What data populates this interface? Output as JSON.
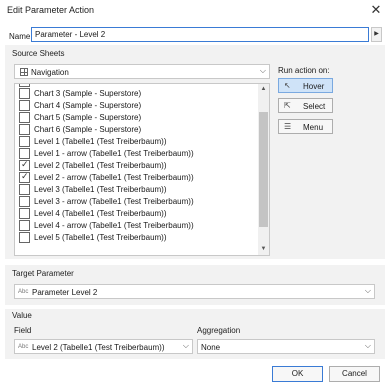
{
  "window": {
    "title": "Edit Parameter Action",
    "close_glyph": "✕"
  },
  "name": {
    "label": "Name:",
    "value": "Parameter - Level 2"
  },
  "source_sheets": {
    "section_label": "Source Sheets",
    "dropdown_value": "Navigation",
    "sheets": [
      {
        "label": "",
        "checked": false
      },
      {
        "label": "Chart 3 (Sample - Superstore)",
        "checked": false
      },
      {
        "label": "Chart 4 (Sample - Superstore)",
        "checked": false
      },
      {
        "label": "Chart 5 (Sample - Superstore)",
        "checked": false
      },
      {
        "label": "Chart 6 (Sample - Superstore)",
        "checked": false
      },
      {
        "label": "Level 1 (Tabelle1 (Test Treiberbaum))",
        "checked": false
      },
      {
        "label": "Level 1 - arrow (Tabelle1 (Test Treiberbaum))",
        "checked": false
      },
      {
        "label": "Level 2 (Tabelle1 (Test Treiberbaum))",
        "checked": true
      },
      {
        "label": "Level 2 - arrow (Tabelle1 (Test Treiberbaum))",
        "checked": true
      },
      {
        "label": "Level 3 (Tabelle1 (Test Treiberbaum))",
        "checked": false
      },
      {
        "label": "Level 3 - arrow (Tabelle1 (Test Treiberbaum))",
        "checked": false
      },
      {
        "label": "Level 4 (Tabelle1 (Test Treiberbaum))",
        "checked": false
      },
      {
        "label": "Level 4 - arrow (Tabelle1 (Test Treiberbaum))",
        "checked": false
      },
      {
        "label": "Level 5 (Tabelle1 (Test Treiberbaum))",
        "checked": false
      }
    ]
  },
  "run_action": {
    "label": "Run action on:",
    "hover": "Hover",
    "select": "Select",
    "menu": "Menu",
    "active": "hover"
  },
  "target": {
    "section_label": "Target Parameter",
    "type_badge": "Abc",
    "value": "Parameter Level 2"
  },
  "value_section": {
    "section_label": "Value",
    "field_label": "Field",
    "field_type_badge": "Abc",
    "field_value": "Level 2 (Tabelle1 (Test Treiberbaum))",
    "aggregation_label": "Aggregation",
    "aggregation_value": "None"
  },
  "buttons": {
    "ok": "OK",
    "cancel": "Cancel"
  },
  "colors": {
    "accent": "#3a7bd5",
    "section_bg": "#f2f2f2",
    "active_button_bg": "#cfe3f8"
  }
}
